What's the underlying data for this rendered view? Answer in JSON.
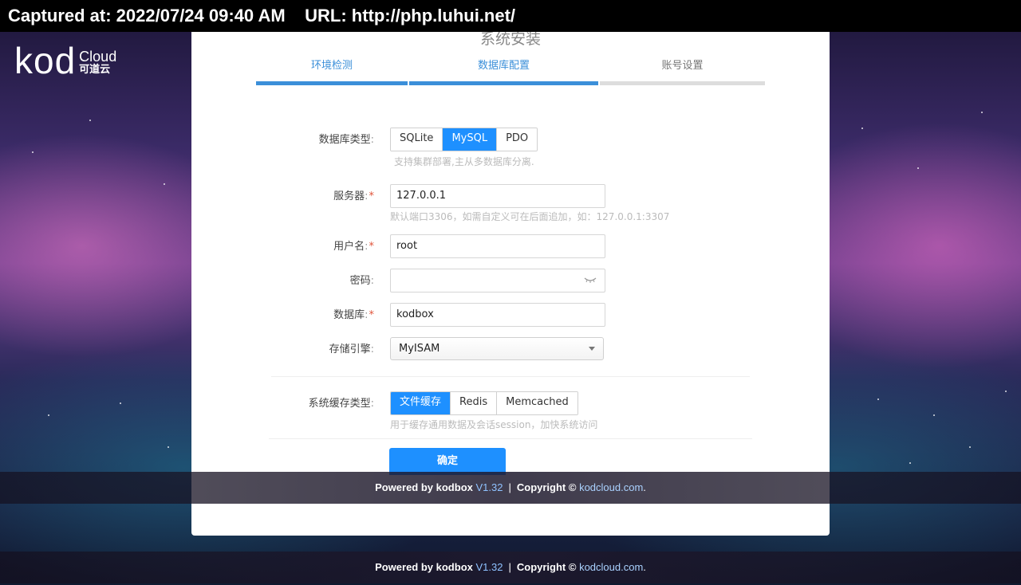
{
  "capture": {
    "text": "Captured at: 2022/07/24 09:40 AM    URL: http://php.luhui.net/"
  },
  "brand": {
    "logo_main": "kod",
    "logo_sub": "Cloud",
    "logo_cn": "可道云"
  },
  "install": {
    "title": "系统安装",
    "steps": [
      {
        "label": "环境检测",
        "state": "done"
      },
      {
        "label": "数据库配置",
        "state": "active"
      },
      {
        "label": "账号设置",
        "state": "todo"
      }
    ]
  },
  "form": {
    "db_type": {
      "label": "数据库类型",
      "options": [
        "SQLite",
        "MySQL",
        "PDO"
      ],
      "selected": "MySQL",
      "hint": "支持集群部署,主从多数据库分离."
    },
    "server": {
      "label": "服务器",
      "value": "127.0.0.1",
      "hint": "默认端口3306，如需自定义可在后面追加，如：127.0.0.1:3307"
    },
    "username": {
      "label": "用户名",
      "value": "root"
    },
    "password": {
      "label": "密码",
      "value": "",
      "icon": "eye-closed-icon"
    },
    "database": {
      "label": "数据库",
      "value": "kodbox"
    },
    "engine": {
      "label": "存储引擎",
      "value": "MyISAM"
    },
    "cache_type": {
      "label": "系统缓存类型",
      "options": [
        "文件缓存",
        "Redis",
        "Memcached"
      ],
      "selected": "文件缓存",
      "hint": "用于缓存通用数据及会话session，加快系统访问"
    },
    "required_mark": "*",
    "colon": ":",
    "confirm_label": "确定"
  },
  "footer": {
    "powered_by": "Powered by kodbox",
    "version": "V1.32",
    "separator": "|",
    "copyright": "Copyright ©",
    "link": "kodcloud.com",
    "end": "."
  },
  "colors": {
    "accent": "#1e90ff",
    "step_blue": "#3b8fd9",
    "required": "#e0543a"
  }
}
